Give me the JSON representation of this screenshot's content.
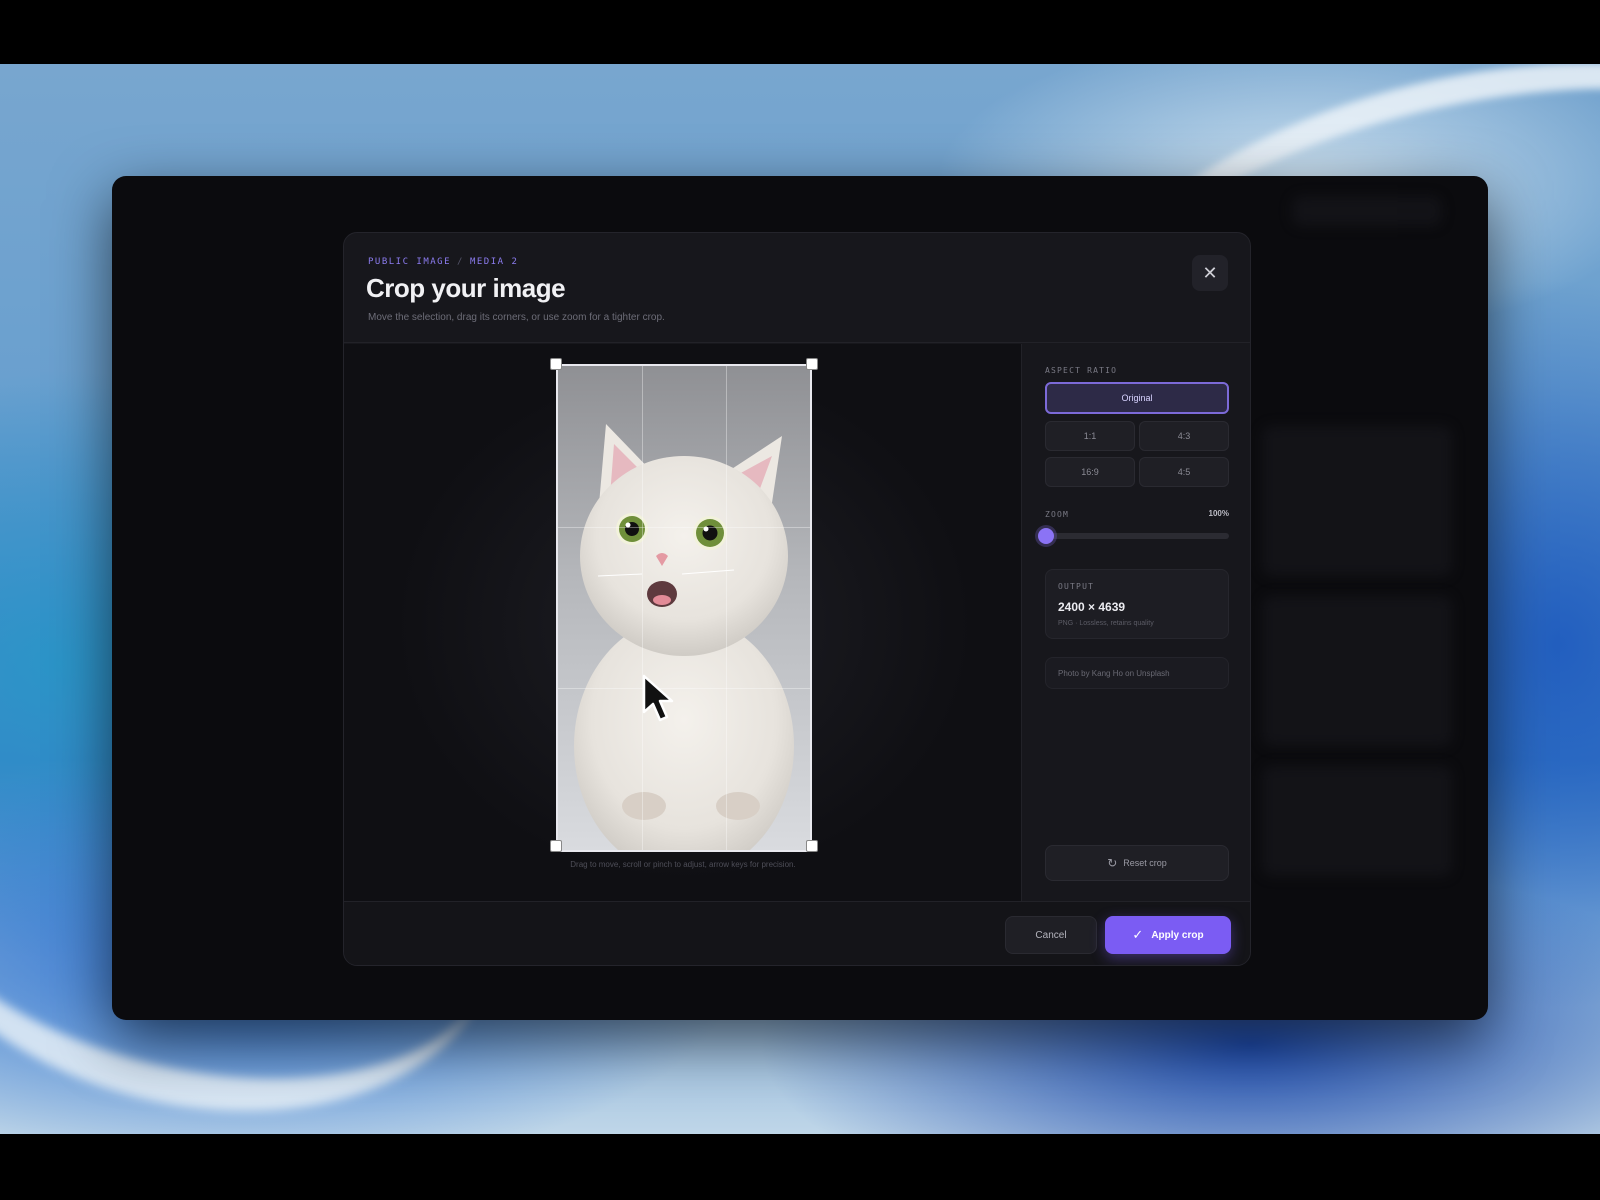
{
  "modal": {
    "breadcrumb": [
      "PUBLIC IMAGE",
      "MEDIA 2"
    ],
    "title": "Crop your image",
    "subtitle": "Move the selection, drag its corners, or use zoom for a tighter crop.",
    "close_icon": "close-icon"
  },
  "canvas": {
    "hint": "Drag to move, scroll or pinch to adjust, arrow keys for precision."
  },
  "sidebar": {
    "aspect_ratio_label": "ASPECT RATIO",
    "ratios": [
      {
        "label": "Original",
        "active": true
      },
      {
        "label": "1:1",
        "active": false
      },
      {
        "label": "4:3",
        "active": false
      },
      {
        "label": "16:9",
        "active": false
      },
      {
        "label": "4:5",
        "active": false
      }
    ],
    "zoom_label": "ZOOM",
    "zoom_value": "100%",
    "zoom_level_percent": 0,
    "output_label": "OUTPUT",
    "output_value": "2400 × 4639",
    "output_sub": "PNG · Lossless, retains quality",
    "credit": "Photo by Kang Ho on Unsplash",
    "reset_label": "Reset crop",
    "reset_icon": "reset-icon"
  },
  "footer": {
    "cancel_label": "Cancel",
    "apply_label": "Apply crop",
    "apply_icon": "check-icon"
  },
  "colors": {
    "accent": "#7b5cf3",
    "modal_bg": "#17171c"
  }
}
